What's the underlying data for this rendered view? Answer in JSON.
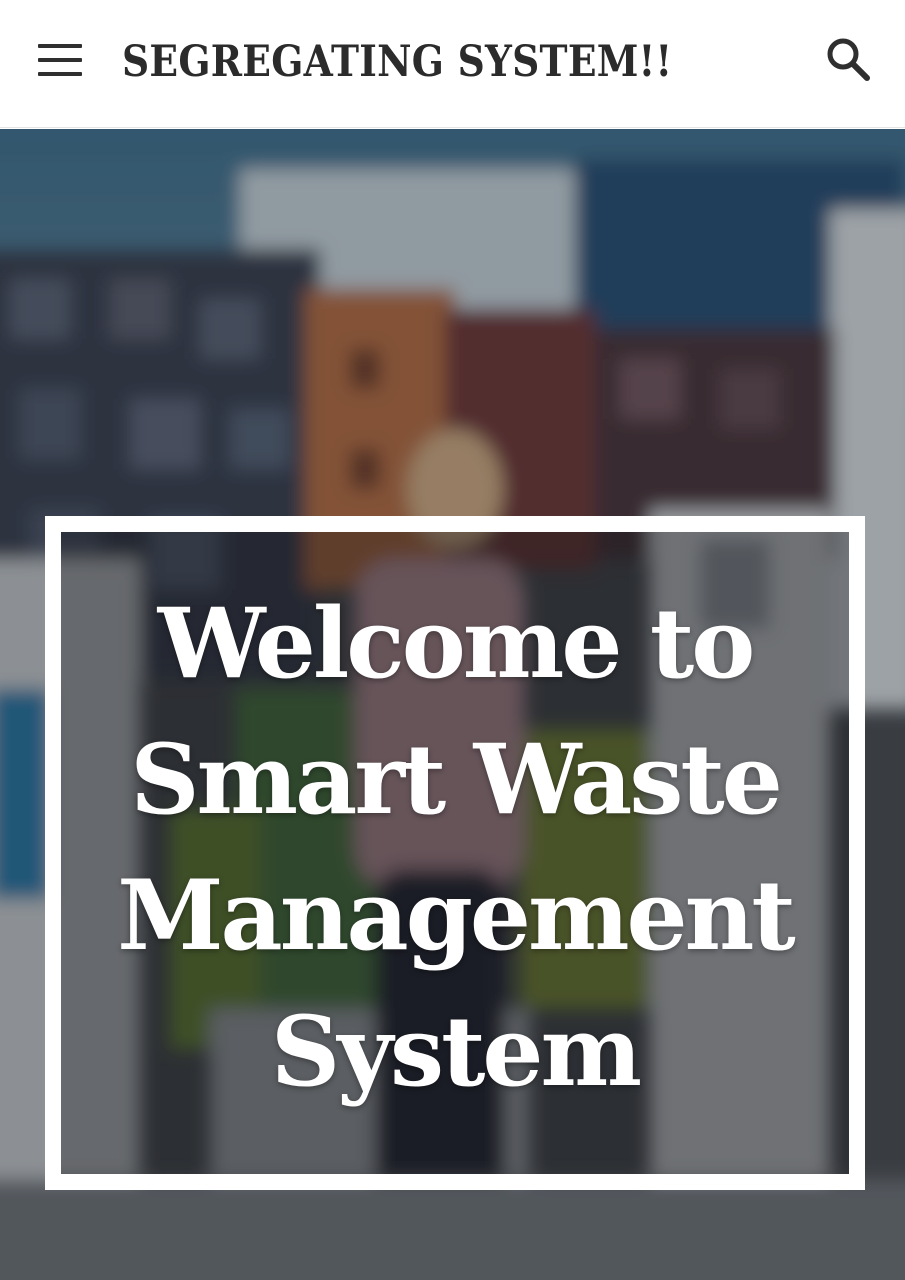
{
  "header": {
    "menu_icon": "hamburger-menu-icon",
    "site_title": "SEGREGATING SYSTEM!!",
    "search_icon": "search-icon"
  },
  "hero": {
    "welcome_text": "Welcome to Smart Waste Management System"
  },
  "colors": {
    "header_background": "#ffffff",
    "title_text": "#2b2b2b",
    "frame_border": "#ffffff",
    "hero_text": "#ffffff"
  }
}
